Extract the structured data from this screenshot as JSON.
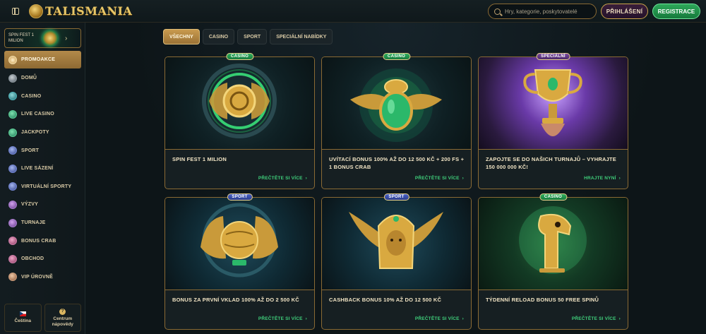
{
  "header": {
    "logo_text": "TALISMANIA",
    "search_placeholder": "Hry, kategorie, poskytovatelé",
    "login_label": "PŘIHLÁŠENÍ",
    "register_label": "REGISTRACE"
  },
  "sidebar": {
    "promo_card_text": "SPIN FEST 1 MILION",
    "items": [
      {
        "label": "PROMOAKCE",
        "icon": "gift-icon"
      },
      {
        "label": "DOMŮ",
        "icon": "home-icon"
      },
      {
        "label": "CASINO",
        "icon": "casino-chip-icon"
      },
      {
        "label": "LIVE CASINO",
        "icon": "live-casino-icon"
      },
      {
        "label": "JACKPOTY",
        "icon": "jackpot-icon"
      },
      {
        "label": "SPORT",
        "icon": "football-icon"
      },
      {
        "label": "LIVE SÁZENÍ",
        "icon": "live-betting-icon"
      },
      {
        "label": "VIRTUÁLNÍ SPORTY",
        "icon": "virtual-sports-icon"
      },
      {
        "label": "VÝZVY",
        "icon": "challenges-icon"
      },
      {
        "label": "TURNAJE",
        "icon": "tournament-icon"
      },
      {
        "label": "BONUS CRAB",
        "icon": "crab-icon"
      },
      {
        "label": "OBCHOD",
        "icon": "shop-icon"
      },
      {
        "label": "VIP ÚROVNĚ",
        "icon": "vip-diamond-icon"
      }
    ],
    "footer": {
      "language_label": "Čeština",
      "help_label": "Centrum nápovědy"
    }
  },
  "filters": [
    "VŠECHNY",
    "CASINO",
    "SPORT",
    "SPECIÁLNÍ NABÍDKY"
  ],
  "cards": [
    {
      "badge": "CASINO",
      "title": "SPIN FEST 1 MILION",
      "link": "PŘEČTĚTE SI VÍCE"
    },
    {
      "badge": "CASINO",
      "title": "UVÍTACÍ BONUS 100% AŽ DO 12 500 KČ + 200 FS + 1 BONUS CRAB",
      "link": "PŘEČTĚTE SI VÍCE"
    },
    {
      "badge": "SPECIÁLNÍ",
      "title": "ZAPOJTE SE DO NAŠICH TURNAJŮ – VYHRAJTE 150 000 000 KČ!",
      "link": "HRAJTE NYNÍ"
    },
    {
      "badge": "SPORT",
      "title": "BONUS ZA PRVNÍ VKLAD 100% AŽ DO 2 500 KČ",
      "link": "PŘEČTĚTE SI VÍCE"
    },
    {
      "badge": "SPORT",
      "title": "CASHBACK BONUS 10% AŽ DO 12 500 KČ",
      "link": "PŘEČTĚTE SI VÍCE"
    },
    {
      "badge": "CASINO",
      "title": "TÝDENNÍ RELOAD BONUS 50 FREE SPINŮ",
      "link": "PŘEČTĚTE SI VÍCE"
    }
  ]
}
